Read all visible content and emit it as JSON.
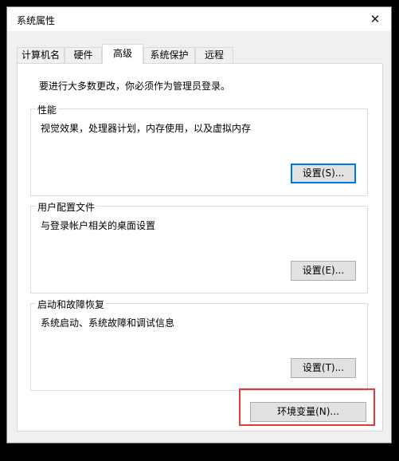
{
  "window": {
    "title": "系统属性",
    "close_glyph": "✕"
  },
  "tabs": [
    {
      "label": "计算机名",
      "active": false
    },
    {
      "label": "硬件",
      "active": false
    },
    {
      "label": "高级",
      "active": true
    },
    {
      "label": "系统保护",
      "active": false
    },
    {
      "label": "远程",
      "active": false
    }
  ],
  "advanced": {
    "admin_note": "要进行大多数更改，你必须作为管理员登录。",
    "performance": {
      "title": "性能",
      "description": "视觉效果，处理器计划，内存使用，以及虚拟内存",
      "button": "设置(S)..."
    },
    "user_profiles": {
      "title": "用户配置文件",
      "description": "与登录帐户相关的桌面设置",
      "button": "设置(E)..."
    },
    "startup_recovery": {
      "title": "启动和故障恢复",
      "description": "系统启动、系统故障和调试信息",
      "button": "设置(T)..."
    },
    "env_button": "环境变量(N)..."
  },
  "colors": {
    "highlight": "#e03c3c",
    "focus": "#0078d7"
  }
}
